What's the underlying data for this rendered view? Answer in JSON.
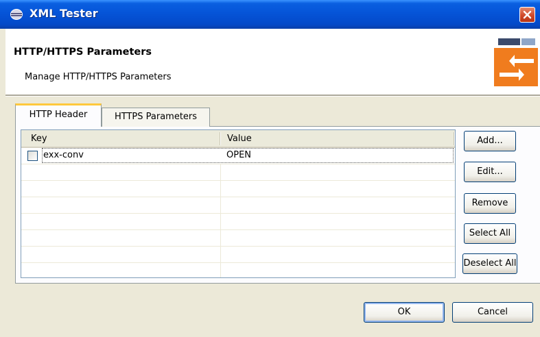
{
  "window": {
    "title": "XML Tester"
  },
  "banner": {
    "title": "HTTP/HTTPS Parameters",
    "description": "Manage HTTP/HTTPS Parameters"
  },
  "tabs": [
    {
      "label": "HTTP Header",
      "active": true
    },
    {
      "label": "HTTPS Parameters",
      "active": false
    }
  ],
  "table": {
    "columns": [
      "Key",
      "Value"
    ],
    "rows": [
      {
        "key": "exx-conv",
        "value": "OPEN",
        "checked": false
      }
    ]
  },
  "side_buttons": {
    "add": "Add...",
    "edit": "Edit...",
    "remove": "Remove",
    "select_all": "Select All",
    "deselect_all": "Deselect All"
  },
  "footer": {
    "ok": "OK",
    "cancel": "Cancel"
  },
  "icons": {
    "app": "eclipse-icon",
    "close": "close-icon",
    "banner": "transfer-arrows-icon"
  },
  "colors": {
    "titlebar": "#0554d8",
    "close": "#d0492a",
    "banner_icon": "#f07c1e",
    "tab_highlight": "#ffc83c"
  }
}
